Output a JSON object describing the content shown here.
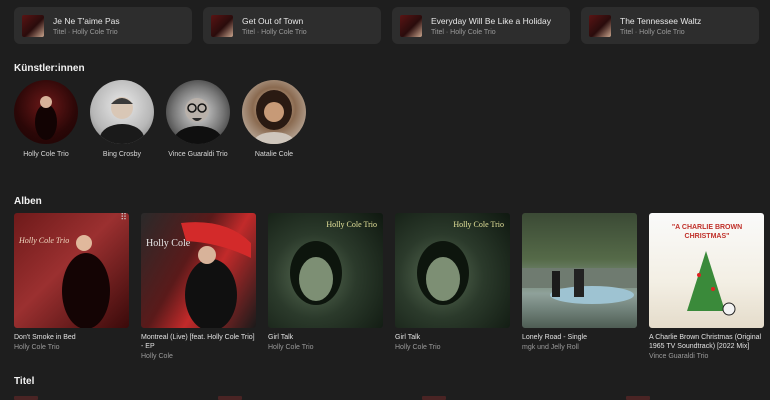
{
  "top_songs": [
    {
      "title": "Je Ne T'aime Pas",
      "subtitle": "Titel · Holly Cole Trio"
    },
    {
      "title": "Get Out of Town",
      "subtitle": "Titel · Holly Cole Trio"
    },
    {
      "title": "Everyday Will Be Like a Holiday",
      "subtitle": "Titel · Holly Cole Trio"
    },
    {
      "title": "The Tennessee Waltz",
      "subtitle": "Titel · Holly Cole Trio"
    }
  ],
  "artists_section": {
    "heading": "Künstler:innen",
    "items": [
      {
        "name": "Holly Cole Trio"
      },
      {
        "name": "Bing Crosby"
      },
      {
        "name": "Vince Guaraldi Trio"
      },
      {
        "name": "Natalie Cole"
      }
    ]
  },
  "albums_section": {
    "heading": "Alben",
    "items": [
      {
        "title": "Don't Smoke in Bed",
        "artist": "Holly Cole Trio",
        "cover_text": "Holly Cole Trio"
      },
      {
        "title": "Montreal (Live) [feat. Holly Cole Trio] - EP",
        "artist": "Holly Cole",
        "cover_text": "Holly Cole"
      },
      {
        "title": "Girl Talk",
        "artist": "Holly Cole Trio",
        "cover_text": "Holly Cole Trio"
      },
      {
        "title": "Girl Talk",
        "artist": "Holly Cole Trio",
        "cover_text": "Holly Cole Trio"
      },
      {
        "title": "Lonely Road - Single",
        "artist": "mgk und Jelly Roll",
        "cover_text": ""
      },
      {
        "title": "A Charlie Brown Christmas (Original 1965 TV Soundtrack) [2022 Mix]",
        "artist": "Vince Guaraldi Trio",
        "cover_text": "\"A CHARLIE BROWN CHRISTMAS\""
      }
    ]
  },
  "titles_section": {
    "heading": "Titel"
  },
  "colors": {
    "background": "#1e1e1e",
    "card": "#2d2d2d",
    "text_secondary": "#9a9a9a"
  }
}
